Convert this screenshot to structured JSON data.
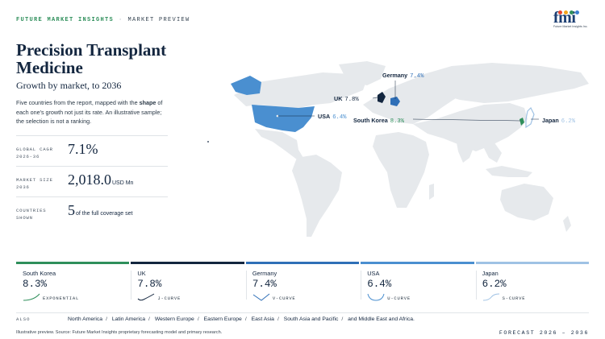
{
  "header": {
    "brand": "FUTURE MARKET INSIGHTS",
    "separator": "·",
    "section": "MARKET PREVIEW",
    "logo_word": "fmi",
    "logo_sub": "Future Market Insights Inc."
  },
  "title": "Precision Transplant Medicine",
  "subtitle": "Growth by market, to 2036",
  "intro": {
    "before": "Five countries from the report, mapped with the ",
    "bold": "shape",
    "after": " of each one's growth not just its rate. An illustrative sample; the selection is not a ranking."
  },
  "stats": [
    {
      "label": "GLOBAL CAGR 2026-36",
      "value": "7.1%",
      "unit": ""
    },
    {
      "label": "MARKET SIZE 2036",
      "value": "2,018.0",
      "unit": "USD Mn"
    },
    {
      "label": "COUNTRIES SHOWN",
      "value": "5",
      "unit": "of the full coverage set"
    }
  ],
  "map_labels": [
    {
      "name": "Germany",
      "pct": "7.4%"
    },
    {
      "name": "UK",
      "pct": "7.8%"
    },
    {
      "name": "USA",
      "pct": "6.4%"
    },
    {
      "name": "South Korea",
      "pct": "8.3%"
    },
    {
      "name": "Japan",
      "pct": "6.2%"
    }
  ],
  "cards": [
    {
      "name": "South Korea",
      "value": "8.3%",
      "curve": "EXPONENTIAL",
      "color": "#2f8f5b"
    },
    {
      "name": "UK",
      "value": "7.8%",
      "curve": "J-CURVE",
      "color": "#13263f"
    },
    {
      "name": "Germany",
      "value": "7.4%",
      "curve": "V-CURVE",
      "color": "#2f6fb7"
    },
    {
      "name": "USA",
      "value": "6.4%",
      "curve": "U-CURVE",
      "color": "#4a8fd0"
    },
    {
      "name": "Japan",
      "value": "6.2%",
      "curve": "S-CURVE",
      "color": "#9fc2e4"
    }
  ],
  "also": {
    "label": "ALSO",
    "regions": [
      "North America",
      "Latin America",
      "Western Europe",
      "Eastern Europe",
      "East Asia",
      "South Asia and Pacific",
      "and Middle East and Africa."
    ],
    "slash": "/"
  },
  "footer": {
    "source": "Illustrative preview. Source: Future Market Insights proprietary forecasting model and primary research.",
    "forecast": "FORECAST 2026 – 2036"
  },
  "colors": {
    "land": "#e6e9ec",
    "highlight_usa": "#4a8fd0",
    "highlight_uk": "#13263f",
    "highlight_germany": "#2f6fb7",
    "highlight_korea": "#2f8f5b",
    "highlight_japan": "#9fc2e4"
  }
}
